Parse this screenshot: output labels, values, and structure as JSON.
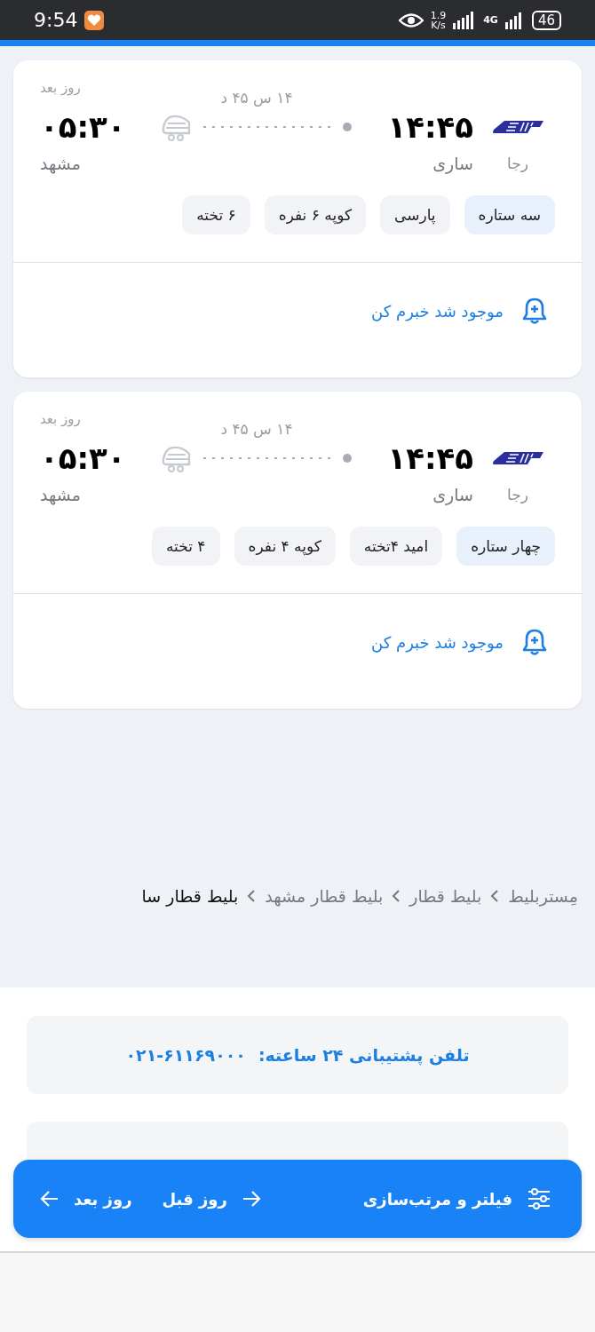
{
  "status_bar": {
    "time": "9:54",
    "speed_value": "1.9",
    "speed_unit": "K/s",
    "network": "4G",
    "battery": "46"
  },
  "trips": [
    {
      "operator": "رجا",
      "depart_time": "۱۴:۴۵",
      "origin": "ساری",
      "duration": "۱۴ س ۴۵ د",
      "arrival_note": "روز بعد",
      "arrive_time": "۰۵:۳۰",
      "destination": "مشهد",
      "tags": [
        {
          "label": "سه ستاره",
          "kind": "class"
        },
        {
          "label": "پارسی",
          "kind": "feature"
        },
        {
          "label": "کوپه ۶ نفره",
          "kind": "feature"
        },
        {
          "label": "۶ تخته",
          "kind": "feature"
        }
      ],
      "notify": "موجود شد خبرم کن"
    },
    {
      "operator": "رجا",
      "depart_time": "۱۴:۴۵",
      "origin": "ساری",
      "duration": "۱۴ س ۴۵ د",
      "arrival_note": "روز بعد",
      "arrive_time": "۰۵:۳۰",
      "destination": "مشهد",
      "tags": [
        {
          "label": "چهار ستاره",
          "kind": "class"
        },
        {
          "label": "امید ۴تخته",
          "kind": "feature"
        },
        {
          "label": "کوپه ۴ نفره",
          "kind": "feature"
        },
        {
          "label": "۴ تخته",
          "kind": "feature"
        }
      ],
      "notify": "موجود شد خبرم کن"
    }
  ],
  "breadcrumb": [
    "مِستربلیط",
    "بلیط قطار",
    "بلیط قطار مشهد",
    "بلیط قطار سا"
  ],
  "support": {
    "phone_label": "تلفن پشتیبانی ۲۴ ساعته:",
    "phone": "۰۲۱-۶۱۱۶۹۰۰۰"
  },
  "bottom_bar": {
    "filter": "فیلتر و مرتب‌سازی",
    "previous_day": "روز قبل",
    "next_day": "روز بعد"
  }
}
